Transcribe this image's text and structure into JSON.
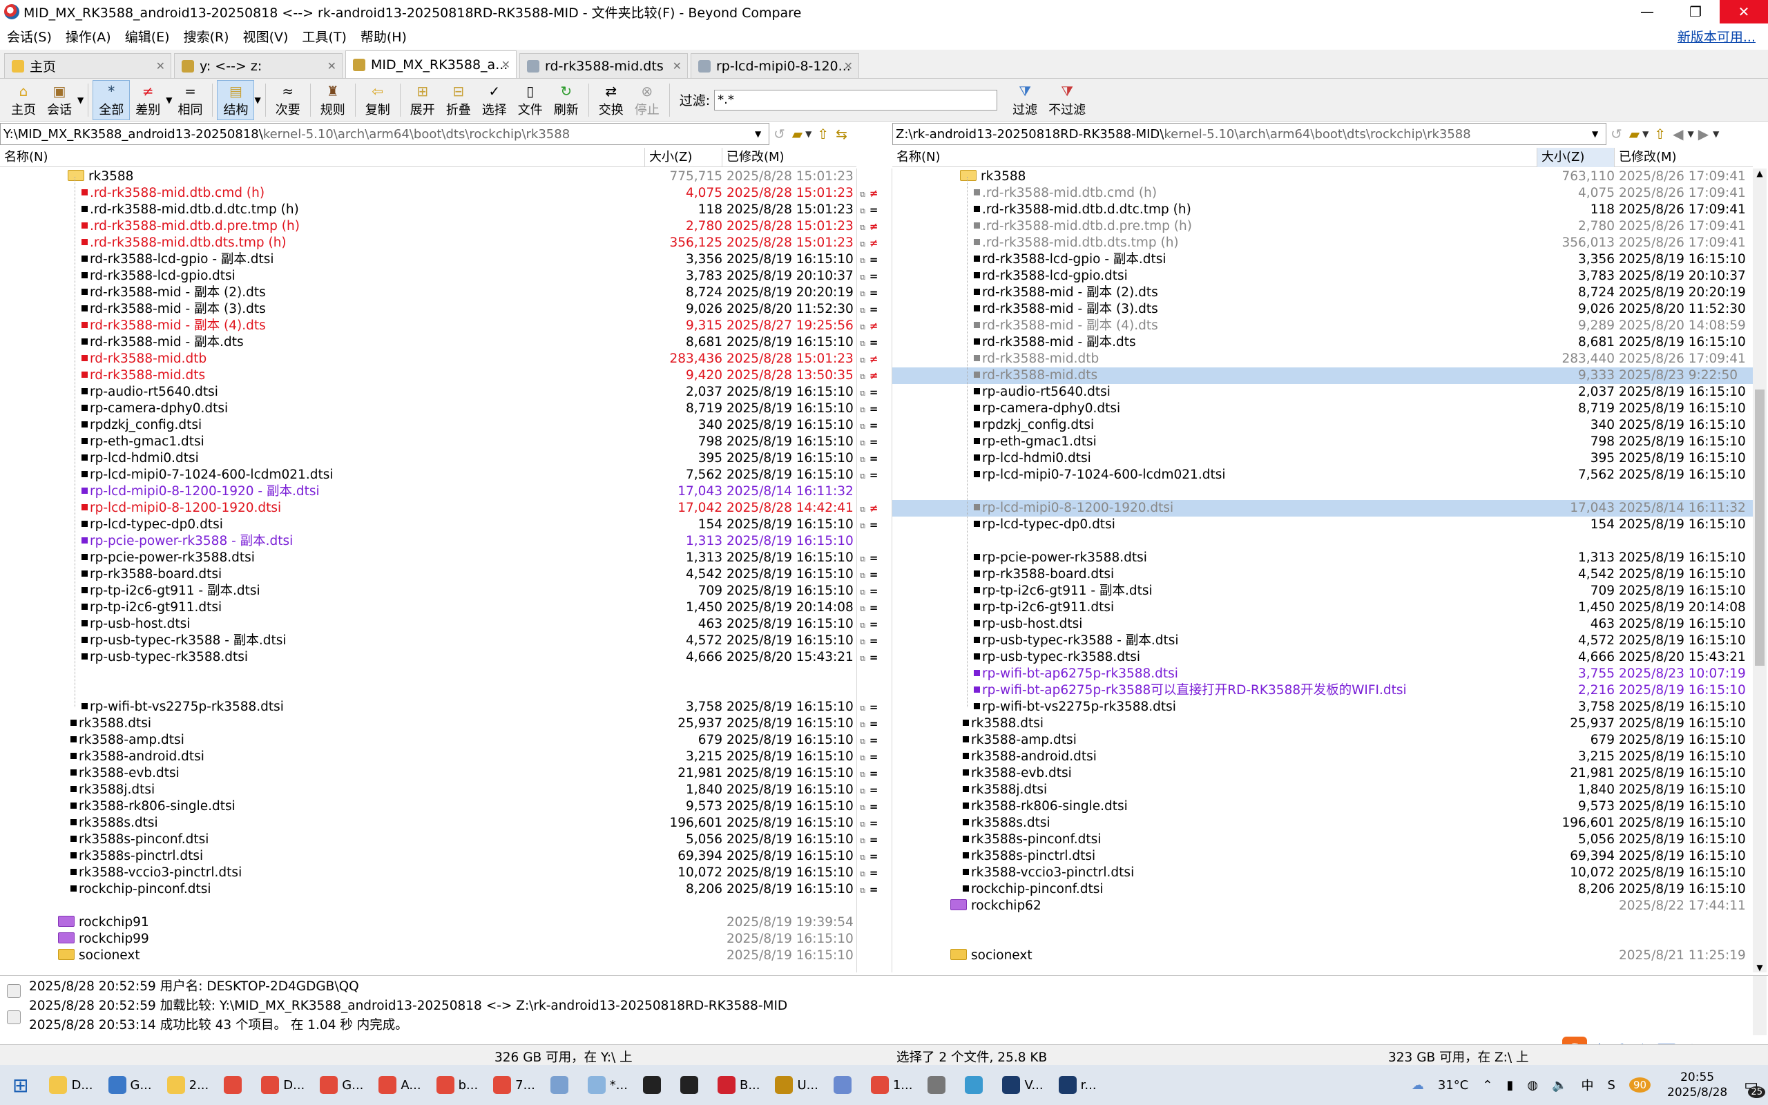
{
  "window": {
    "title": "MID_MX_RK3588_android13-20250818 <--> rk-android13-20250818RD-RK3588-MID - 文件夹比较(F) - Beyond Compare",
    "min": "—",
    "max": "❐",
    "close": "✕"
  },
  "menu": {
    "items": [
      "会话(S)",
      "操作(A)",
      "编辑(E)",
      "搜索(R)",
      "视图(V)",
      "工具(T)",
      "帮助(H)"
    ],
    "new_version": "新版本可用..."
  },
  "tabs": [
    {
      "label": "主页"
    },
    {
      "label": "y: <--> z:"
    },
    {
      "label": "MID_MX_RK3588_a..."
    },
    {
      "label": "rd-rk3588-mid.dts"
    },
    {
      "label": "rp-lcd-mipi0-8-120..."
    }
  ],
  "toolbar": {
    "home": "主页",
    "session": "会话",
    "all": "全部",
    "diff": "差别",
    "same": "相同",
    "structure": "结构",
    "minor": "次要",
    "rules": "规则",
    "copy": "复制",
    "expand": "展开",
    "collapse": "折叠",
    "select": "选择",
    "files": "文件",
    "refresh": "刷新",
    "swap": "交换",
    "stop": "停止",
    "filter_label": "过滤:",
    "filter_value": "*.*",
    "filter_btn": "过滤",
    "nofilter_btn": "不过滤"
  },
  "left": {
    "path_main": "Y:\\MID_MX_RK3588_android13-20250818\\",
    "path_rest": "kernel-5.10\\arch\\arm64\\boot\\dts\\rockchip\\rk3588",
    "col_name": "名称(N)",
    "col_size": "大小(Z)",
    "col_mod": "已修改(M)",
    "folder": {
      "name": "rk3588",
      "size": "775,715",
      "date": "2025/8/28 15:01:23"
    },
    "rows": [
      {
        "n": ".rd-rk3588-mid.dtb.cmd (h)",
        "s": "4,075",
        "d": "2025/8/28 15:01:23",
        "c": "red",
        "m": "≠"
      },
      {
        "n": ".rd-rk3588-mid.dtb.d.dtc.tmp (h)",
        "s": "118",
        "d": "2025/8/28 15:01:23",
        "c": "black",
        "m": "="
      },
      {
        "n": ".rd-rk3588-mid.dtb.d.pre.tmp (h)",
        "s": "2,780",
        "d": "2025/8/28 15:01:23",
        "c": "red",
        "m": "≠"
      },
      {
        "n": ".rd-rk3588-mid.dtb.dts.tmp (h)",
        "s": "356,125",
        "d": "2025/8/28 15:01:23",
        "c": "red",
        "m": "≠"
      },
      {
        "n": "rd-rk3588-lcd-gpio - 副本.dtsi",
        "s": "3,356",
        "d": "2025/8/19 16:15:10",
        "c": "black",
        "m": "="
      },
      {
        "n": "rd-rk3588-lcd-gpio.dtsi",
        "s": "3,783",
        "d": "2025/8/19 20:10:37",
        "c": "black",
        "m": "="
      },
      {
        "n": "rd-rk3588-mid - 副本 (2).dts",
        "s": "8,724",
        "d": "2025/8/19 20:20:19",
        "c": "black",
        "m": "="
      },
      {
        "n": "rd-rk3588-mid - 副本 (3).dts",
        "s": "9,026",
        "d": "2025/8/20 11:52:30",
        "c": "black",
        "m": "="
      },
      {
        "n": "rd-rk3588-mid - 副本 (4).dts",
        "s": "9,315",
        "d": "2025/8/27 19:25:56",
        "c": "red",
        "m": "≠"
      },
      {
        "n": "rd-rk3588-mid - 副本.dts",
        "s": "8,681",
        "d": "2025/8/19 16:15:10",
        "c": "black",
        "m": "="
      },
      {
        "n": "rd-rk3588-mid.dtb",
        "s": "283,436",
        "d": "2025/8/28 15:01:23",
        "c": "red",
        "m": "≠"
      },
      {
        "n": "rd-rk3588-mid.dts",
        "s": "9,420",
        "d": "2025/8/28 13:50:35",
        "c": "red",
        "m": "≠"
      },
      {
        "n": "rp-audio-rt5640.dtsi",
        "s": "2,037",
        "d": "2025/8/19 16:15:10",
        "c": "black",
        "m": "="
      },
      {
        "n": "rp-camera-dphy0.dtsi",
        "s": "8,719",
        "d": "2025/8/19 16:15:10",
        "c": "black",
        "m": "="
      },
      {
        "n": "rpdzkj_config.dtsi",
        "s": "340",
        "d": "2025/8/19 16:15:10",
        "c": "black",
        "m": "="
      },
      {
        "n": "rp-eth-gmac1.dtsi",
        "s": "798",
        "d": "2025/8/19 16:15:10",
        "c": "black",
        "m": "="
      },
      {
        "n": "rp-lcd-hdmi0.dtsi",
        "s": "395",
        "d": "2025/8/19 16:15:10",
        "c": "black",
        "m": "="
      },
      {
        "n": "rp-lcd-mipi0-7-1024-600-lcdm021.dtsi",
        "s": "7,562",
        "d": "2025/8/19 16:15:10",
        "c": "black",
        "m": "="
      },
      {
        "n": "rp-lcd-mipi0-8-1200-1920 - 副本.dtsi",
        "s": "17,043",
        "d": "2025/8/14 16:11:32",
        "c": "pur",
        "m": ""
      },
      {
        "n": "rp-lcd-mipi0-8-1200-1920.dtsi",
        "s": "17,042",
        "d": "2025/8/28 14:42:41",
        "c": "red",
        "m": "≠"
      },
      {
        "n": "rp-lcd-typec-dp0.dtsi",
        "s": "154",
        "d": "2025/8/19 16:15:10",
        "c": "black",
        "m": "="
      },
      {
        "n": "rp-pcie-power-rk3588 - 副本.dtsi",
        "s": "1,313",
        "d": "2025/8/19 16:15:10",
        "c": "pur",
        "m": ""
      },
      {
        "n": "rp-pcie-power-rk3588.dtsi",
        "s": "1,313",
        "d": "2025/8/19 16:15:10",
        "c": "black",
        "m": "="
      },
      {
        "n": "rp-rk3588-board.dtsi",
        "s": "4,542",
        "d": "2025/8/19 16:15:10",
        "c": "black",
        "m": "="
      },
      {
        "n": "rp-tp-i2c6-gt911 - 副本.dtsi",
        "s": "709",
        "d": "2025/8/19 16:15:10",
        "c": "black",
        "m": "="
      },
      {
        "n": "rp-tp-i2c6-gt911.dtsi",
        "s": "1,450",
        "d": "2025/8/19 20:14:08",
        "c": "black",
        "m": "="
      },
      {
        "n": "rp-usb-host.dtsi",
        "s": "463",
        "d": "2025/8/19 16:15:10",
        "c": "black",
        "m": "="
      },
      {
        "n": "rp-usb-typec-rk3588 - 副本.dtsi",
        "s": "4,572",
        "d": "2025/8/19 16:15:10",
        "c": "black",
        "m": "="
      },
      {
        "n": "rp-usb-typec-rk3588.dtsi",
        "s": "4,666",
        "d": "2025/8/20 15:43:21",
        "c": "black",
        "m": "="
      },
      {
        "n": "",
        "s": "",
        "d": "",
        "c": "black",
        "m": ""
      },
      {
        "n": "",
        "s": "",
        "d": "",
        "c": "black",
        "m": ""
      },
      {
        "n": "rp-wifi-bt-vs2275p-rk3588.dtsi",
        "s": "3,758",
        "d": "2025/8/19 16:15:10",
        "c": "black",
        "m": "="
      }
    ],
    "rows2": [
      {
        "n": "rk3588.dtsi",
        "s": "25,937",
        "d": "2025/8/19 16:15:10",
        "m": "="
      },
      {
        "n": "rk3588-amp.dtsi",
        "s": "679",
        "d": "2025/8/19 16:15:10",
        "m": "="
      },
      {
        "n": "rk3588-android.dtsi",
        "s": "3,215",
        "d": "2025/8/19 16:15:10",
        "m": "="
      },
      {
        "n": "rk3588-evb.dtsi",
        "s": "21,981",
        "d": "2025/8/19 16:15:10",
        "m": "="
      },
      {
        "n": "rk3588j.dtsi",
        "s": "1,840",
        "d": "2025/8/19 16:15:10",
        "m": "="
      },
      {
        "n": "rk3588-rk806-single.dtsi",
        "s": "9,573",
        "d": "2025/8/19 16:15:10",
        "m": "="
      },
      {
        "n": "rk3588s.dtsi",
        "s": "196,601",
        "d": "2025/8/19 16:15:10",
        "m": "="
      },
      {
        "n": "rk3588s-pinconf.dtsi",
        "s": "5,056",
        "d": "2025/8/19 16:15:10",
        "m": "="
      },
      {
        "n": "rk3588s-pinctrl.dtsi",
        "s": "69,394",
        "d": "2025/8/19 16:15:10",
        "m": "="
      },
      {
        "n": "rk3588-vccio3-pinctrl.dtsi",
        "s": "10,072",
        "d": "2025/8/19 16:15:10",
        "m": "="
      },
      {
        "n": "rockchip-pinconf.dtsi",
        "s": "8,206",
        "d": "2025/8/19 16:15:10",
        "m": "="
      }
    ],
    "folders2": [
      {
        "n": "",
        "d": "",
        "t": "blank"
      },
      {
        "n": "rockchip91",
        "d": "2025/8/19 19:39:54",
        "t": "p"
      },
      {
        "n": "rockchip99",
        "d": "2025/8/19 16:15:10",
        "t": "p"
      },
      {
        "n": "socionext",
        "d": "2025/8/19 16:15:10",
        "t": "y"
      }
    ]
  },
  "right": {
    "path_main": "Z:\\rk-android13-20250818RD-RK3588-MID\\",
    "path_rest": "kernel-5.10\\arch\\arm64\\boot\\dts\\rockchip\\rk3588",
    "col_name": "名称(N)",
    "col_size": "大小(Z)",
    "col_mod": "已修改(M)",
    "folder": {
      "name": "rk3588",
      "size": "763,110",
      "date": "2025/8/26 17:09:41"
    },
    "rows": [
      {
        "n": ".rd-rk3588-mid.dtb.cmd (h)",
        "s": "4,075",
        "d": "2025/8/26 17:09:41",
        "c": "grey"
      },
      {
        "n": ".rd-rk3588-mid.dtb.d.dtc.tmp (h)",
        "s": "118",
        "d": "2025/8/26 17:09:41",
        "c": "black"
      },
      {
        "n": ".rd-rk3588-mid.dtb.d.pre.tmp (h)",
        "s": "2,780",
        "d": "2025/8/26 17:09:41",
        "c": "grey"
      },
      {
        "n": ".rd-rk3588-mid.dtb.dts.tmp (h)",
        "s": "356,013",
        "d": "2025/8/26 17:09:41",
        "c": "grey"
      },
      {
        "n": "rd-rk3588-lcd-gpio - 副本.dtsi",
        "s": "3,356",
        "d": "2025/8/19 16:15:10",
        "c": "black"
      },
      {
        "n": "rd-rk3588-lcd-gpio.dtsi",
        "s": "3,783",
        "d": "2025/8/19 20:10:37",
        "c": "black"
      },
      {
        "n": "rd-rk3588-mid - 副本 (2).dts",
        "s": "8,724",
        "d": "2025/8/19 20:20:19",
        "c": "black"
      },
      {
        "n": "rd-rk3588-mid - 副本 (3).dts",
        "s": "9,026",
        "d": "2025/8/20 11:52:30",
        "c": "black"
      },
      {
        "n": "rd-rk3588-mid - 副本 (4).dts",
        "s": "9,289",
        "d": "2025/8/20 14:08:59",
        "c": "grey"
      },
      {
        "n": "rd-rk3588-mid - 副本.dts",
        "s": "8,681",
        "d": "2025/8/19 16:15:10",
        "c": "black"
      },
      {
        "n": "rd-rk3588-mid.dtb",
        "s": "283,440",
        "d": "2025/8/26 17:09:41",
        "c": "grey"
      },
      {
        "n": "rd-rk3588-mid.dts",
        "s": "9,333",
        "d": "2025/8/23 9:22:50",
        "c": "grey",
        "hl": true
      },
      {
        "n": "rp-audio-rt5640.dtsi",
        "s": "2,037",
        "d": "2025/8/19 16:15:10",
        "c": "black"
      },
      {
        "n": "rp-camera-dphy0.dtsi",
        "s": "8,719",
        "d": "2025/8/19 16:15:10",
        "c": "black"
      },
      {
        "n": "rpdzkj_config.dtsi",
        "s": "340",
        "d": "2025/8/19 16:15:10",
        "c": "black"
      },
      {
        "n": "rp-eth-gmac1.dtsi",
        "s": "798",
        "d": "2025/8/19 16:15:10",
        "c": "black"
      },
      {
        "n": "rp-lcd-hdmi0.dtsi",
        "s": "395",
        "d": "2025/8/19 16:15:10",
        "c": "black"
      },
      {
        "n": "rp-lcd-mipi0-7-1024-600-lcdm021.dtsi",
        "s": "7,562",
        "d": "2025/8/19 16:15:10",
        "c": "black"
      },
      {
        "n": "",
        "s": "",
        "d": "",
        "c": "black"
      },
      {
        "n": "rp-lcd-mipi0-8-1200-1920.dtsi",
        "s": "17,043",
        "d": "2025/8/14 16:11:32",
        "c": "grey",
        "hl": true
      },
      {
        "n": "rp-lcd-typec-dp0.dtsi",
        "s": "154",
        "d": "2025/8/19 16:15:10",
        "c": "black"
      },
      {
        "n": "",
        "s": "",
        "d": "",
        "c": "black"
      },
      {
        "n": "rp-pcie-power-rk3588.dtsi",
        "s": "1,313",
        "d": "2025/8/19 16:15:10",
        "c": "black"
      },
      {
        "n": "rp-rk3588-board.dtsi",
        "s": "4,542",
        "d": "2025/8/19 16:15:10",
        "c": "black"
      },
      {
        "n": "rp-tp-i2c6-gt911 - 副本.dtsi",
        "s": "709",
        "d": "2025/8/19 16:15:10",
        "c": "black"
      },
      {
        "n": "rp-tp-i2c6-gt911.dtsi",
        "s": "1,450",
        "d": "2025/8/19 20:14:08",
        "c": "black"
      },
      {
        "n": "rp-usb-host.dtsi",
        "s": "463",
        "d": "2025/8/19 16:15:10",
        "c": "black"
      },
      {
        "n": "rp-usb-typec-rk3588 - 副本.dtsi",
        "s": "4,572",
        "d": "2025/8/19 16:15:10",
        "c": "black"
      },
      {
        "n": "rp-usb-typec-rk3588.dtsi",
        "s": "4,666",
        "d": "2025/8/20 15:43:21",
        "c": "black"
      },
      {
        "n": "rp-wifi-bt-ap6275p-rk3588.dtsi",
        "s": "3,755",
        "d": "2025/8/23 10:07:19",
        "c": "pur"
      },
      {
        "n": "rp-wifi-bt-ap6275p-rk3588可以直接打开RD-RK3588开发板的WIFI.dtsi",
        "s": "2,216",
        "d": "2025/8/19 16:15:10",
        "c": "pur"
      },
      {
        "n": "rp-wifi-bt-vs2275p-rk3588.dtsi",
        "s": "3,758",
        "d": "2025/8/19 16:15:10",
        "c": "black"
      }
    ],
    "rows2": [
      {
        "n": "rk3588.dtsi",
        "s": "25,937",
        "d": "2025/8/19 16:15:10"
      },
      {
        "n": "rk3588-amp.dtsi",
        "s": "679",
        "d": "2025/8/19 16:15:10"
      },
      {
        "n": "rk3588-android.dtsi",
        "s": "3,215",
        "d": "2025/8/19 16:15:10"
      },
      {
        "n": "rk3588-evb.dtsi",
        "s": "21,981",
        "d": "2025/8/19 16:15:10"
      },
      {
        "n": "rk3588j.dtsi",
        "s": "1,840",
        "d": "2025/8/19 16:15:10"
      },
      {
        "n": "rk3588-rk806-single.dtsi",
        "s": "9,573",
        "d": "2025/8/19 16:15:10"
      },
      {
        "n": "rk3588s.dtsi",
        "s": "196,601",
        "d": "2025/8/19 16:15:10"
      },
      {
        "n": "rk3588s-pinconf.dtsi",
        "s": "5,056",
        "d": "2025/8/19 16:15:10"
      },
      {
        "n": "rk3588s-pinctrl.dtsi",
        "s": "69,394",
        "d": "2025/8/19 16:15:10"
      },
      {
        "n": "rk3588-vccio3-pinctrl.dtsi",
        "s": "10,072",
        "d": "2025/8/19 16:15:10"
      },
      {
        "n": "rockchip-pinconf.dtsi",
        "s": "8,206",
        "d": "2025/8/19 16:15:10"
      }
    ],
    "folders2": [
      {
        "n": "rockchip62",
        "d": "2025/8/22 17:44:11",
        "t": "p"
      },
      {
        "n": "",
        "d": "",
        "t": "blank"
      },
      {
        "n": "",
        "d": "",
        "t": "blank"
      },
      {
        "n": "socionext",
        "d": "2025/8/21 11:25:19",
        "t": "y"
      }
    ]
  },
  "log": [
    "2025/8/28 20:52:59  用户名: DESKTOP-2D4GDGB\\QQ",
    "2025/8/28 20:52:59  加载比较: Y:\\MID_MX_RK3588_android13-20250818 <-> Z:\\rk-android13-20250818RD-RK3588-MID",
    "2025/8/28 20:53:14  成功比较 43 个项目。 在 1.04 秒 内完成。"
  ],
  "status": {
    "left": "326 GB 可用，在 Y:\\ 上",
    "mid": "选择了 2 个文件, 25.8 KB",
    "right": "323 GB 可用，在 Z:\\ 上"
  },
  "taskbar": {
    "items": [
      "D...",
      "G...",
      "2...",
      "",
      "D...",
      "G...",
      "A...",
      "b...",
      "7...",
      "",
      "*...",
      "",
      "",
      "B...",
      "U...",
      "",
      "1...",
      "",
      "",
      "V...",
      "r..."
    ],
    "weather": "31°C",
    "time": "20:55",
    "date": "2025/8/28",
    "notif": "25",
    "ime": "中",
    "badge": "90"
  },
  "colors": {
    "diff": "#e0141e",
    "orphan": "#7a1fd6",
    "older": "#888888",
    "highlight": "#c1d8f1"
  }
}
